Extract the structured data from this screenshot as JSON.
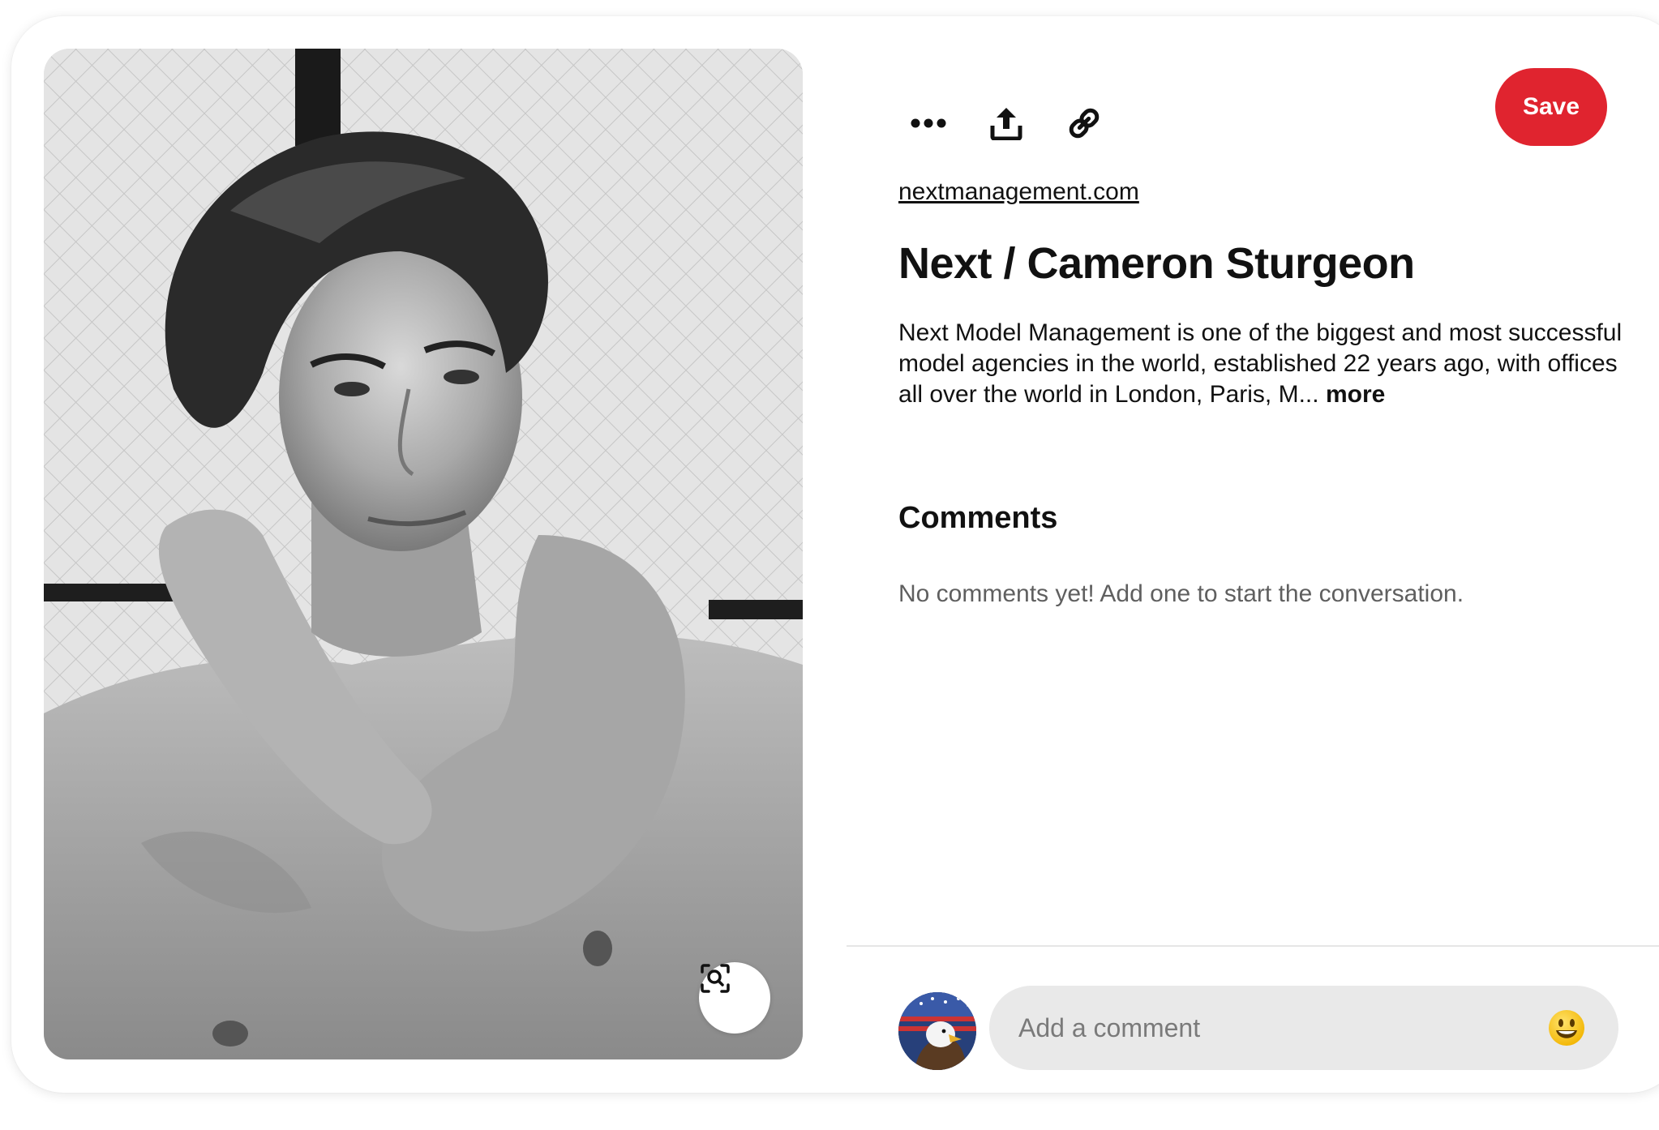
{
  "pin": {
    "source_link": "nextmanagement.com",
    "title": "Next / Cameron Sturgeon",
    "description": "Next Model Management is one of the biggest and most successful model agencies in the world, established 22 years ago, with offices all over the world in London, Paris, M...",
    "more_label": "more"
  },
  "toolbar": {
    "save_label": "Save",
    "icons": [
      "more-options-icon",
      "share-icon",
      "copy-link-icon"
    ]
  },
  "comments": {
    "heading": "Comments",
    "empty_text": "No comments yet! Add one to start the conversation.",
    "input_placeholder": "Add a comment",
    "emoji_icon": "smiley-emoji-icon"
  },
  "colors": {
    "save_button": "#e0242f",
    "comment_box": "#e9e9e9",
    "muted_text": "#5f5f5f"
  }
}
